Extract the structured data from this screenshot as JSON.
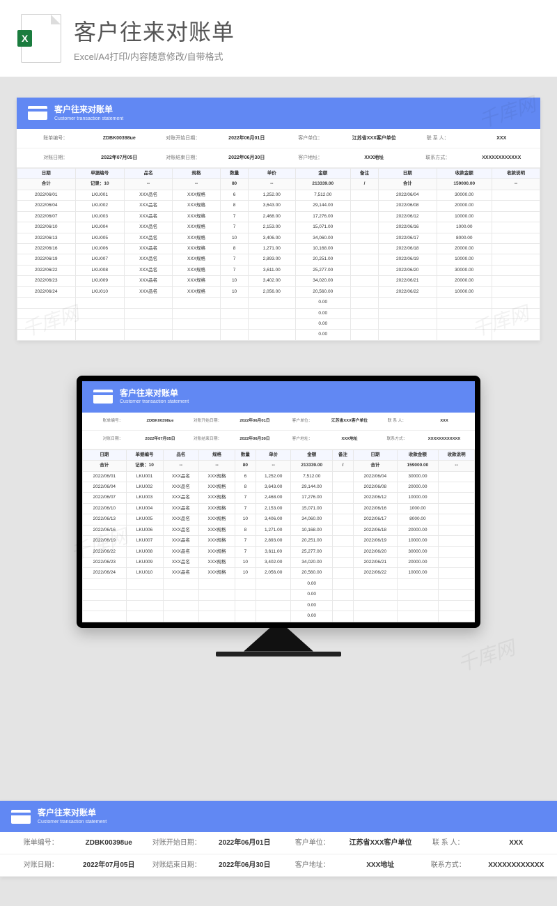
{
  "hero": {
    "title": "客户往来对账单",
    "subtitle": "Excel/A4打印/内容随意修改/自带格式",
    "excel_x": "X"
  },
  "watermark": "千库网",
  "doc": {
    "header_title": "客户往来对账单",
    "header_sub": "Customer transaction statement",
    "info_labels": {
      "bill_no": "账单编号：",
      "start": "对账开始日期：",
      "cust_unit": "客户单位：",
      "contact": "联 系 人：",
      "bill_date": "对账日期：",
      "end": "对账结束日期：",
      "cust_addr": "客户地址：",
      "contact_way": "联系方式："
    },
    "info_values": {
      "bill_no": "ZDBK00398ue",
      "start": "2022年06月01日",
      "cust_unit": "江苏省XXX客户单位",
      "contact": "XXX",
      "bill_date": "2022年07月05日",
      "end": "2022年06月30日",
      "cust_addr": "XXX地址",
      "contact_way": "XXXXXXXXXXXX"
    },
    "cols": [
      "日期",
      "单据编号",
      "品名",
      "规格",
      "数量",
      "单价",
      "金额",
      "备注",
      "日期",
      "收款金额",
      "收款说明"
    ],
    "sum_row": [
      "合计",
      "记录：10",
      "--",
      "--",
      "80",
      "--",
      "213339.00",
      "/",
      "合计",
      "159000.00",
      "--"
    ],
    "rows": [
      [
        "2022/06/01",
        "LKU001",
        "XXX品名",
        "XXX规格",
        "6",
        "1,252.00",
        "7,512.00",
        "",
        "2022/06/04",
        "30000.00",
        ""
      ],
      [
        "2022/06/04",
        "LKU002",
        "XXX品名",
        "XXX规格",
        "8",
        "3,643.00",
        "29,144.00",
        "",
        "2022/06/08",
        "20000.00",
        ""
      ],
      [
        "2022/06/07",
        "LKU003",
        "XXX品名",
        "XXX规格",
        "7",
        "2,468.00",
        "17,276.00",
        "",
        "2022/06/12",
        "10000.00",
        ""
      ],
      [
        "2022/06/10",
        "LKU004",
        "XXX品名",
        "XXX规格",
        "7",
        "2,153.00",
        "15,071.00",
        "",
        "2022/06/16",
        "1000.00",
        ""
      ],
      [
        "2022/06/13",
        "LKU005",
        "XXX品名",
        "XXX规格",
        "10",
        "3,406.00",
        "34,060.00",
        "",
        "2022/06/17",
        "8000.00",
        ""
      ],
      [
        "2022/06/16",
        "LKU006",
        "XXX品名",
        "XXX规格",
        "8",
        "1,271.00",
        "10,168.00",
        "",
        "2022/06/18",
        "20000.00",
        ""
      ],
      [
        "2022/06/19",
        "LKU007",
        "XXX品名",
        "XXX规格",
        "7",
        "2,893.00",
        "20,251.00",
        "",
        "2022/06/19",
        "10000.00",
        ""
      ],
      [
        "2022/06/22",
        "LKU008",
        "XXX品名",
        "XXX规格",
        "7",
        "3,611.00",
        "25,277.00",
        "",
        "2022/06/20",
        "30000.00",
        ""
      ],
      [
        "2022/06/23",
        "LKU009",
        "XXX品名",
        "XXX规格",
        "10",
        "3,402.00",
        "34,020.00",
        "",
        "2022/06/21",
        "20000.00",
        ""
      ],
      [
        "2022/06/24",
        "LKU010",
        "XXX品名",
        "XXX规格",
        "10",
        "2,056.00",
        "20,560.00",
        "",
        "2022/06/22",
        "10000.00",
        ""
      ]
    ],
    "trailing_amounts": [
      "0.00",
      "0.00",
      "0.00",
      "0.00"
    ]
  }
}
